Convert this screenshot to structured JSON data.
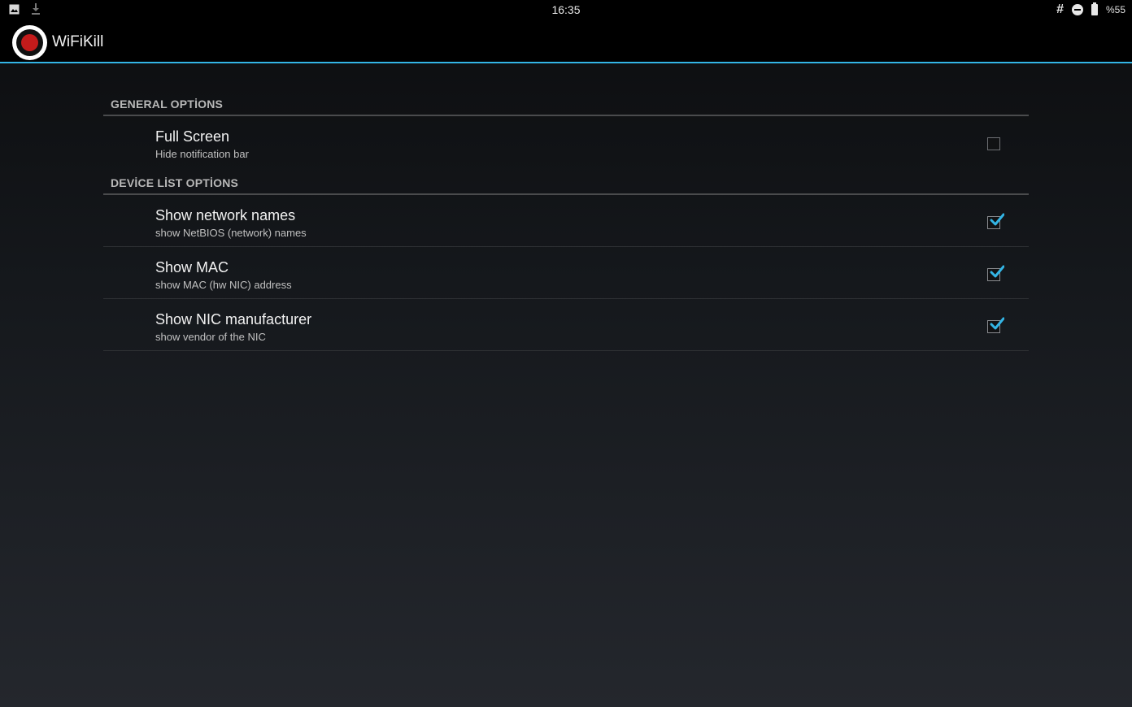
{
  "status_bar": {
    "time": "16:35",
    "battery_text": "%55",
    "left_icons": [
      "image-icon",
      "download-icon"
    ],
    "right_icons": [
      "hash-icon",
      "do-not-disturb-icon",
      "battery-icon"
    ]
  },
  "action_bar": {
    "title": "WiFiKill",
    "accent_color": "#33b5e5",
    "logo_color": "#c41b1b"
  },
  "categories": [
    {
      "title": "GENERAL OPTİONS",
      "items": [
        {
          "title": "Full Screen",
          "summary": "Hide notification bar",
          "checked": false
        }
      ]
    },
    {
      "title": "DEVİCE LİST OPTİONS",
      "items": [
        {
          "title": "Show network names",
          "summary": "show NetBIOS (network) names",
          "checked": true
        },
        {
          "title": "Show MAC",
          "summary": "show MAC (hw NIC) address",
          "checked": true
        },
        {
          "title": "Show NIC manufacturer",
          "summary": "show vendor of the NIC",
          "checked": true
        }
      ]
    }
  ]
}
